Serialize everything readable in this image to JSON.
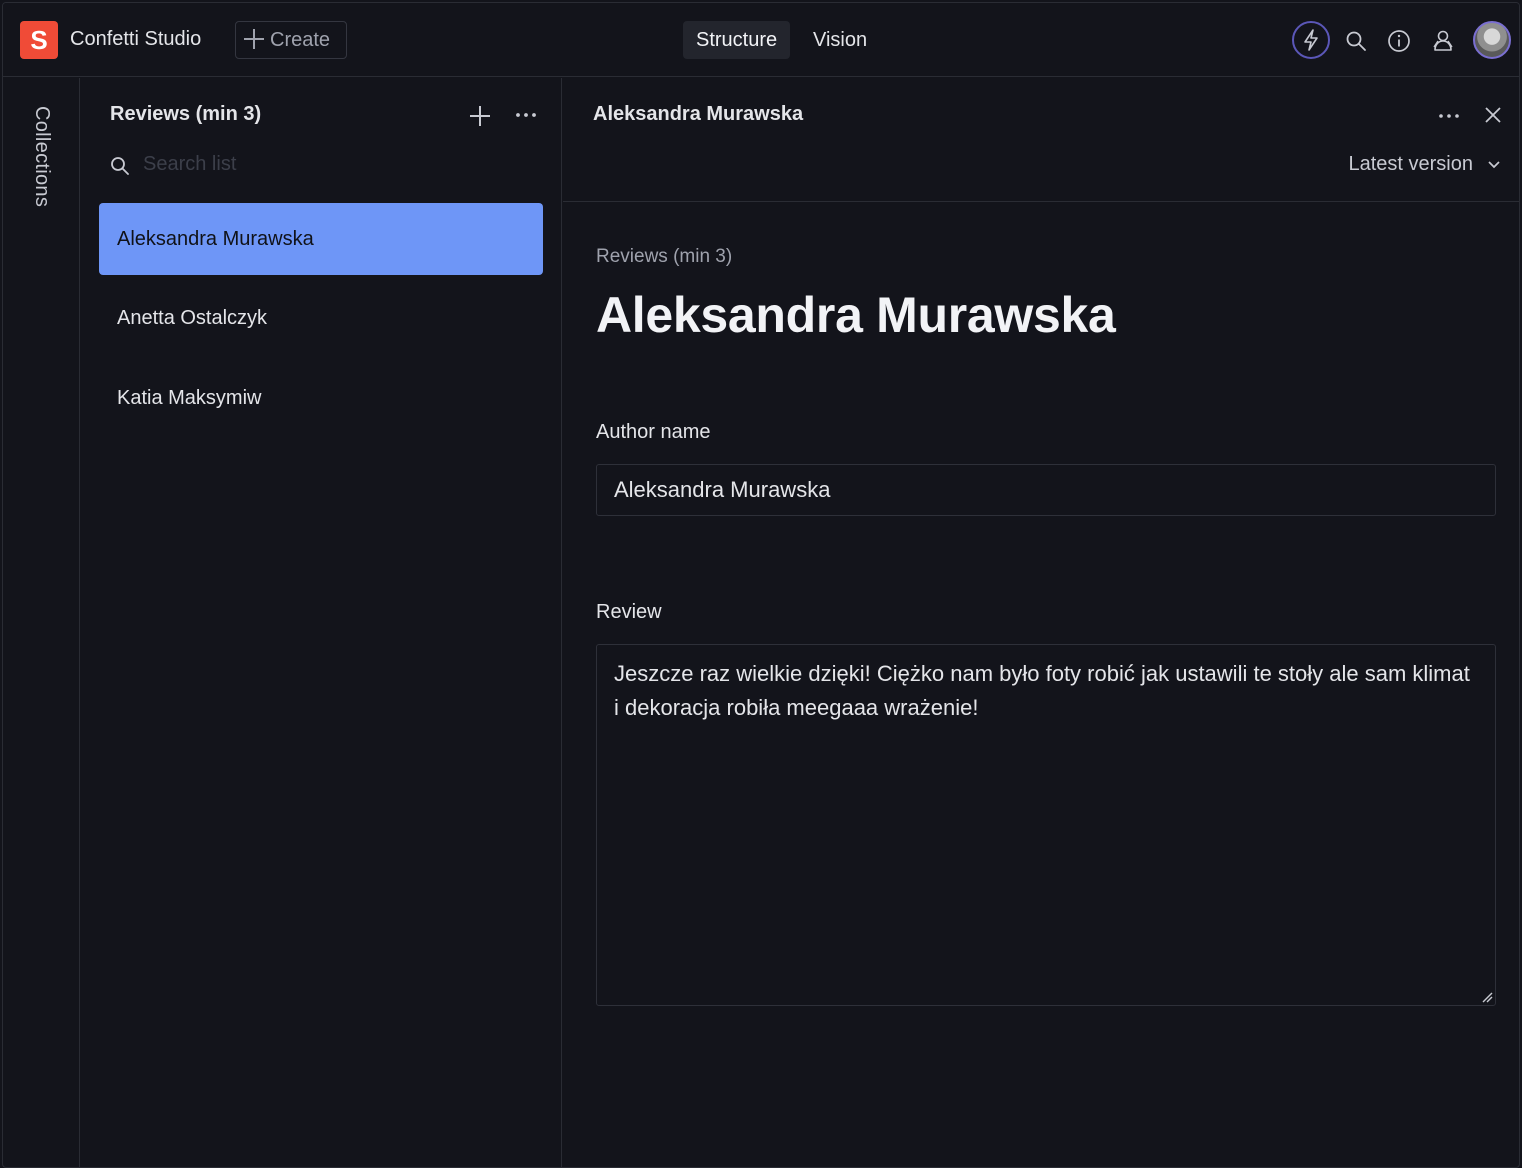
{
  "app": {
    "logo_letter": "S",
    "studio_name": "Confetti Studio",
    "create_label": "Create"
  },
  "tabs": [
    {
      "label": "Structure",
      "active": true
    },
    {
      "label": "Vision",
      "active": false
    }
  ],
  "toolbar_icons": [
    "bolt-icon",
    "search-icon",
    "info-icon",
    "people-icon",
    "avatar"
  ],
  "rail": {
    "label": "Collections"
  },
  "list": {
    "title": "Reviews (min 3)",
    "search_placeholder": "Search list",
    "items": [
      {
        "label": "Aleksandra Murawska",
        "selected": true
      },
      {
        "label": "Anetta Ostalczyk",
        "selected": false
      },
      {
        "label": "Katia Maksymiw",
        "selected": false
      }
    ]
  },
  "document": {
    "header_title": "Aleksandra Murawska",
    "version_label": "Latest version",
    "kicker": "Reviews (min 3)",
    "title": "Aleksandra Murawska",
    "fields": {
      "author": {
        "label": "Author name",
        "value": "Aleksandra Murawska"
      },
      "review": {
        "label": "Review",
        "value": "Jeszcze raz wielkie dzięki! Ciężko nam było foty robić jak ustawili te stoły ale sam klimat i dekoracja robiła meegaaa wrażenie!"
      }
    }
  },
  "colors": {
    "background": "#13141b",
    "accent_selected": "#6e96f7",
    "brand": "#f04b37"
  }
}
